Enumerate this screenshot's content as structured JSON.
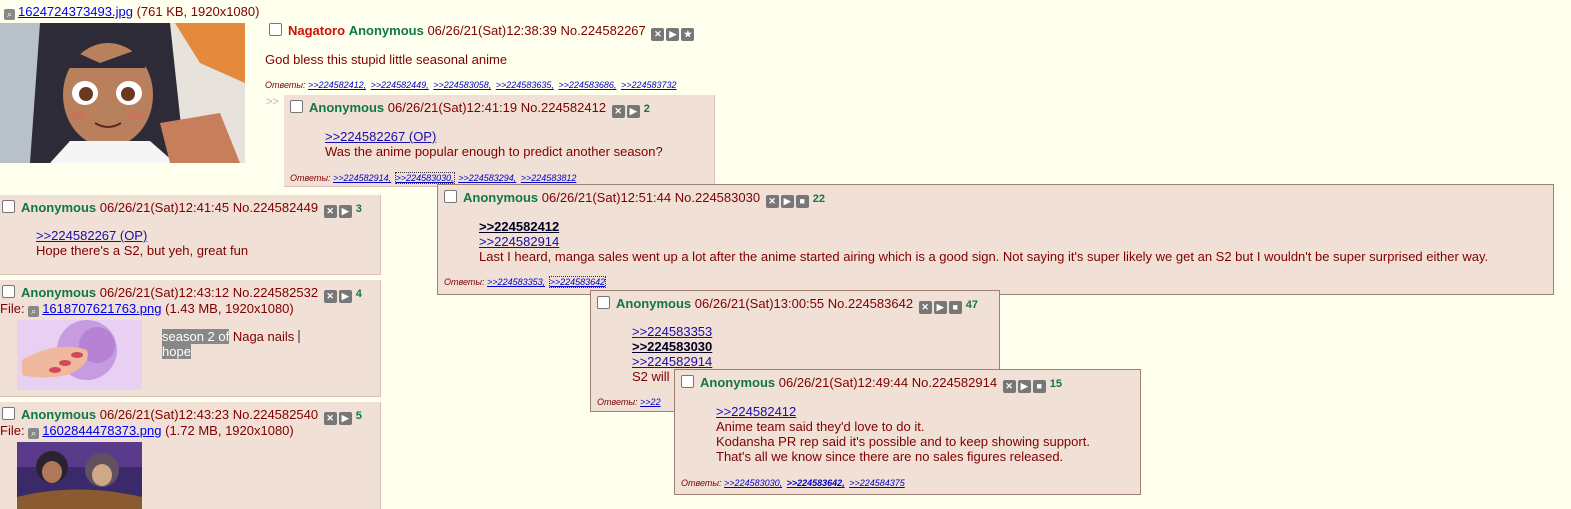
{
  "op": {
    "file_name": "1624724373493.jpg",
    "file_meta": "(761 KB, 1920x1080)",
    "trip": "Nagatoro",
    "name": "Anonymous",
    "date": "06/26/21(Sat)12:38:39",
    "postno": "No.224582267",
    "text": "God bless this stupid little seasonal anime",
    "replies_label": "Ответы:",
    "replies": [
      ">>224582412,",
      ">>224582449,",
      ">>224583058,",
      ">>224583635,",
      ">>224583686,",
      ">>224583732"
    ]
  },
  "post_412": {
    "arrow": ">>",
    "name": "Anonymous",
    "date": "06/26/21(Sat)12:41:19",
    "postno": "No.224582412",
    "count": "2",
    "quote": ">>224582267 (OP)",
    "text": "Was the anime popular enough to predict another season?",
    "replies_label": "Ответы:",
    "replies": [
      ">>224582914,",
      ">>224583030,",
      ">>224583294,",
      ">>224583812"
    ]
  },
  "post_449": {
    "name": "Anonymous",
    "date": "06/26/21(Sat)12:41:45",
    "postno": "No.224582449",
    "count": "3",
    "quote": ">>224582267 (OP)",
    "text": "Hope there's a S2, but yeh, great fun"
  },
  "post_532": {
    "name": "Anonymous",
    "date": "06/26/21(Sat)12:43:12",
    "postno": "No.224582532",
    "count": "4",
    "file_label": "File:",
    "file_name": "1618707621763.png",
    "file_meta": "(1.43 MB, 1920x1080)",
    "text_hl1": "season 2 of",
    "text_mid": " Naga nails",
    "text_hl2": "hope"
  },
  "post_540": {
    "name": "Anonymous",
    "date": "06/26/21(Sat)12:43:23",
    "postno": "No.224582540",
    "count": "5",
    "file_label": "File:",
    "file_name": "1602844478373.png",
    "file_meta": "(1.72 MB, 1920x1080)"
  },
  "hover_030": {
    "name": "Anonymous",
    "date": "06/26/21(Sat)12:51:44",
    "postno": "No.224583030",
    "count": "22",
    "quote1": ">>224582412",
    "quote2": ">>224582914",
    "text": "Last I heard, manga sales went up a lot after the anime started airing which is a good sign. Not saying it's super likely we get an S2 but I wouldn't be super surprised either way.",
    "replies_label": "Ответы:",
    "replies": [
      ">>224583353,",
      ">>224583642"
    ]
  },
  "hover_642": {
    "name": "Anonymous",
    "date": "06/26/21(Sat)13:00:55",
    "postno": "No.224583642",
    "count": "47",
    "quote1": ">>224583353",
    "quote2": ">>224583030",
    "quote3": ">>224582914",
    "text_partial": "S2 will",
    "replies_label": "Ответы:",
    "replies_partial": ">>22"
  },
  "hover_914": {
    "name": "Anonymous",
    "date": "06/26/21(Sat)12:49:44",
    "postno": "No.224582914",
    "count": "15",
    "quote": ">>224582412",
    "line1": "Anime team said they'd love to do it.",
    "line2": "Kodansha PR rep said it's possible and to keep showing support.",
    "line3": "That's all we know since there are no sales figures released.",
    "replies_label": "Ответы:",
    "replies": [
      ">>224583030,",
      ">>224583642,",
      ">>224584375"
    ]
  },
  "icons": {
    "hide": "✕",
    "play": "▶",
    "star": "★",
    "menu": "■",
    "search": "🔍"
  }
}
